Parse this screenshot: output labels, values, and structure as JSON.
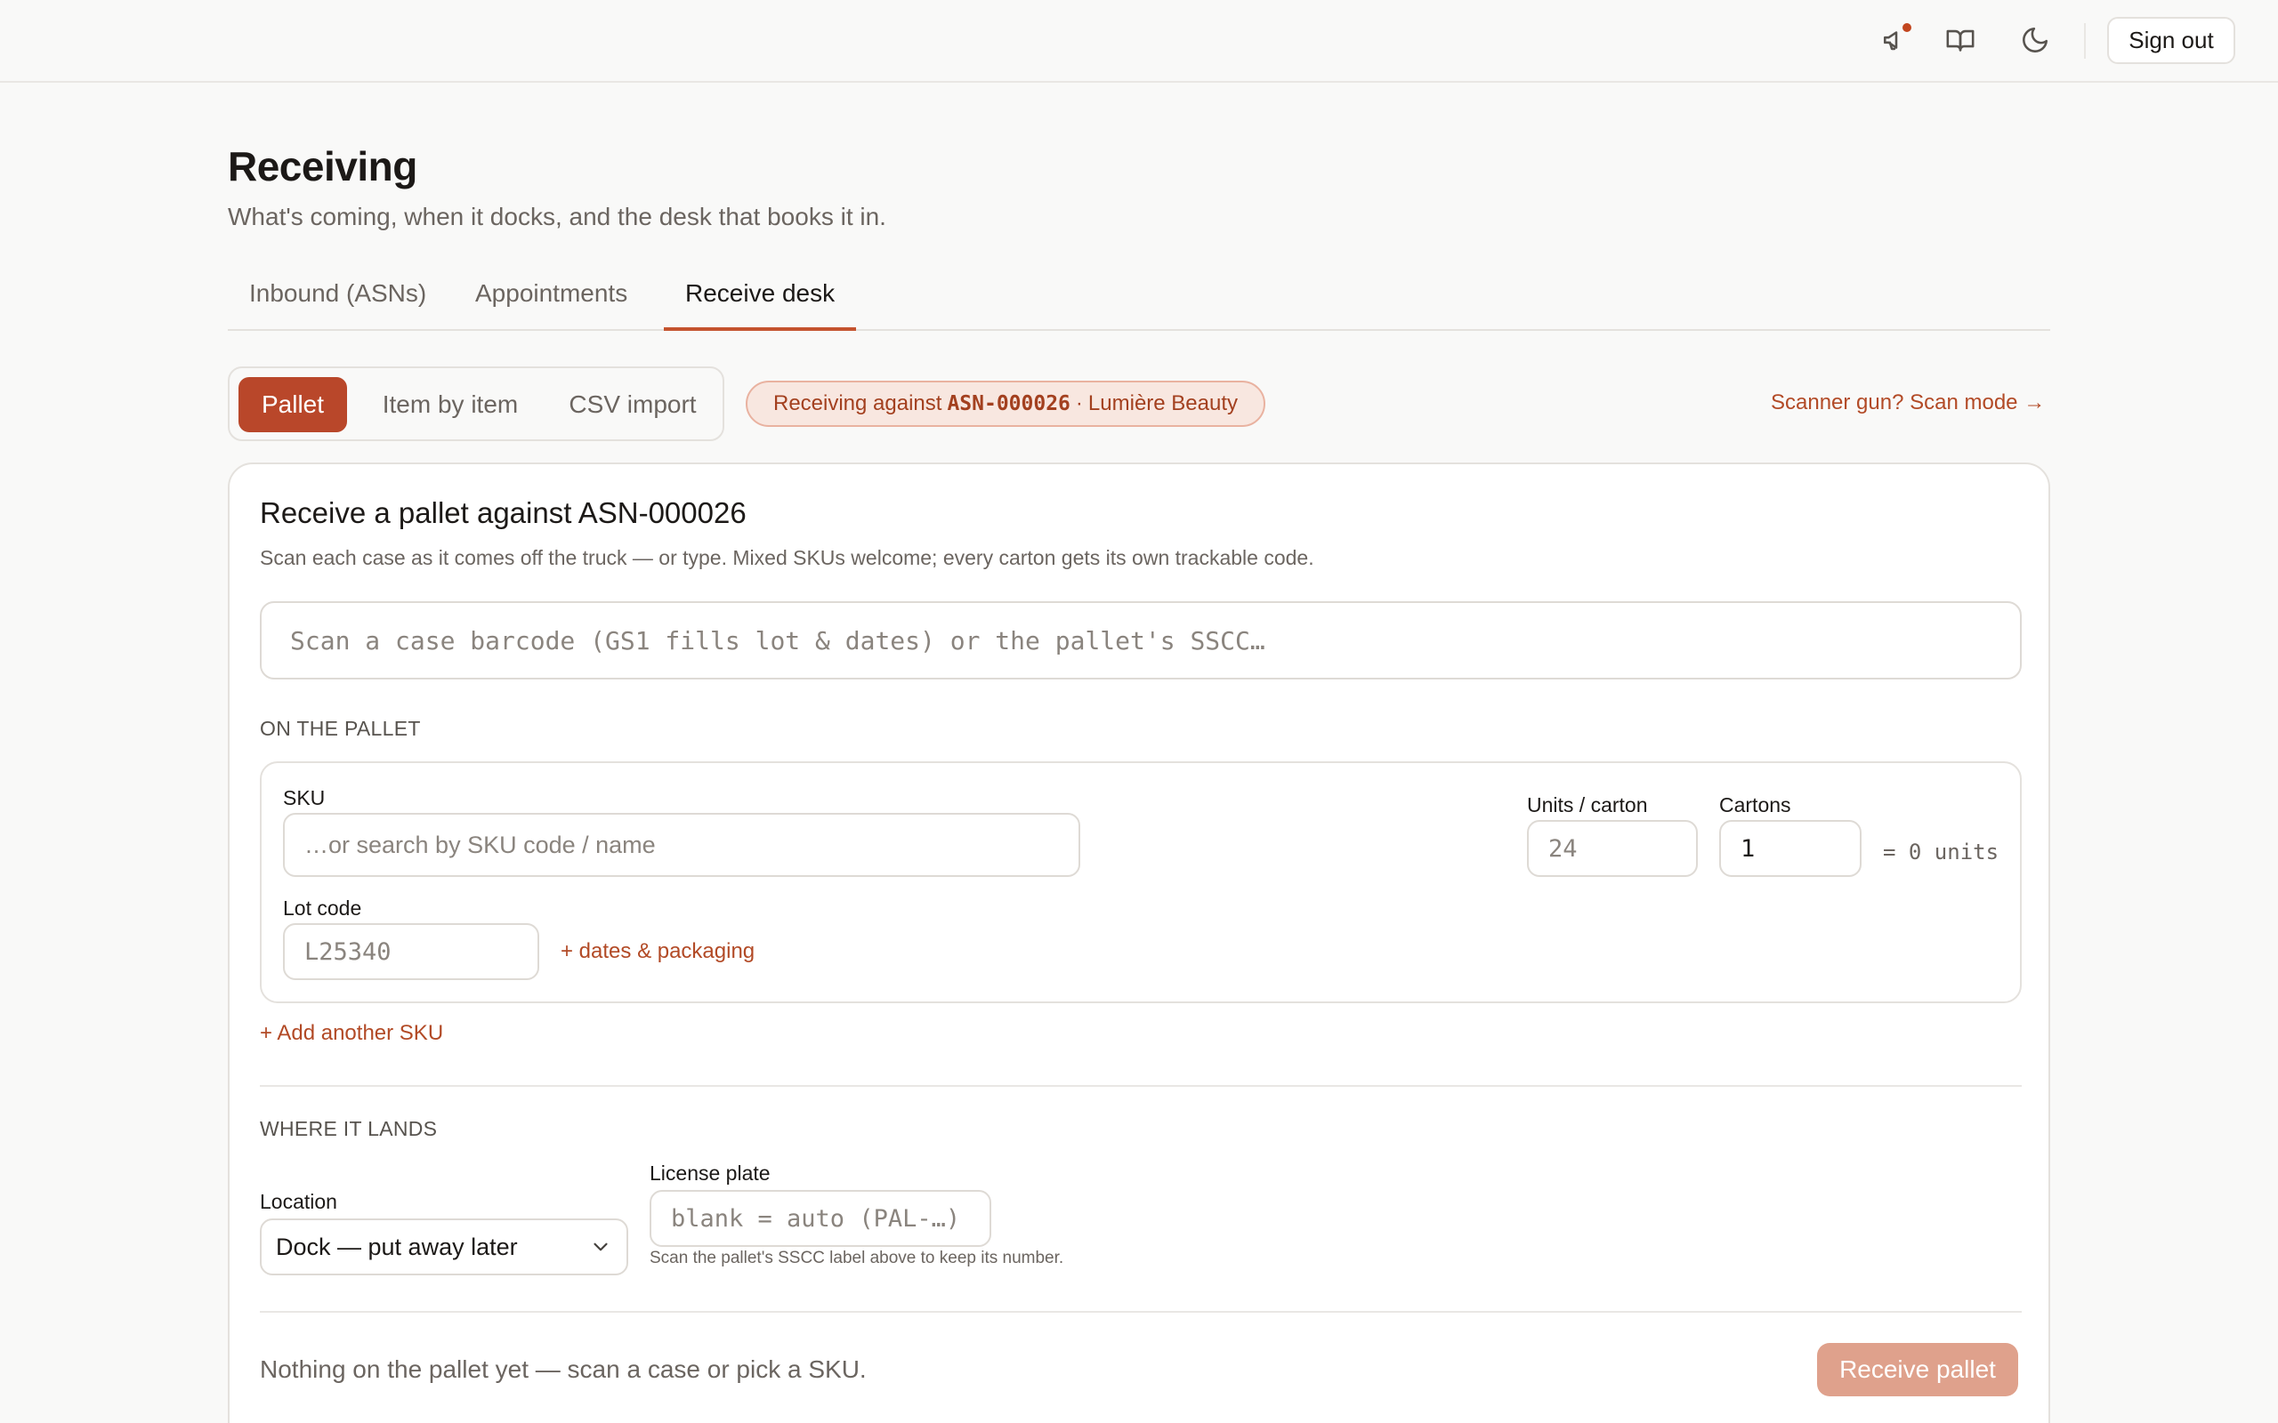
{
  "topbar": {
    "icons": [
      "megaphone-icon",
      "book-open-icon",
      "moon-icon"
    ],
    "notification_color": "#c2461f",
    "signout_label": "Sign out"
  },
  "header": {
    "title": "Receiving",
    "subtitle": "What's coming, when it docks, and the desk that books it in."
  },
  "tabs": [
    {
      "label": "Inbound (ASNs)",
      "active": false
    },
    {
      "label": "Appointments",
      "active": false
    },
    {
      "label": "Receive desk",
      "active": true
    }
  ],
  "mode_switch": {
    "options": [
      "Pallet",
      "Item by item",
      "CSV import"
    ],
    "selected": "Pallet"
  },
  "asn_badge": {
    "prefix": "Receiving against",
    "asn": "ASN-000026",
    "separator": "·",
    "customer": "Lumière Beauty"
  },
  "scan_mode_link": "Scanner gun? Scan mode →",
  "card": {
    "title": "Receive a pallet against ASN-000026",
    "description": "Scan each case as it comes off the truck — or type. Mixed SKUs welcome; every carton gets its own trackable code.",
    "scan_placeholder": "Scan a case barcode (GS1 fills lot & dates) or the pallet's SSCC…",
    "on_pallet_label": "ON THE PALLET",
    "line": {
      "sku_label": "SKU",
      "sku_placeholder": "…or search by SKU code / name",
      "units_label": "Units / carton",
      "units_value": "24",
      "cartons_label": "Cartons",
      "cartons_value": "1",
      "units_total": "= 0 units",
      "lot_label": "Lot code",
      "lot_value": "L25340",
      "dates_link": "+ dates & packaging"
    },
    "add_sku_link": "+ Add another SKU",
    "where_label": "WHERE IT LANDS",
    "location_label": "Location",
    "location_value": "Dock — put away later",
    "plate_label": "License plate",
    "plate_placeholder": "blank = auto (PAL-…)",
    "plate_hint": "Scan the pallet's SSCC label above to keep its number.",
    "empty_message": "Nothing on the pallet yet — scan a case or pick a SKU.",
    "receive_button": "Receive pallet"
  },
  "colors": {
    "accent": "#b9472a",
    "accent_link": "#b24a26",
    "badge_bg": "#f8e7e0",
    "disabled_button": "#dfa18c"
  }
}
